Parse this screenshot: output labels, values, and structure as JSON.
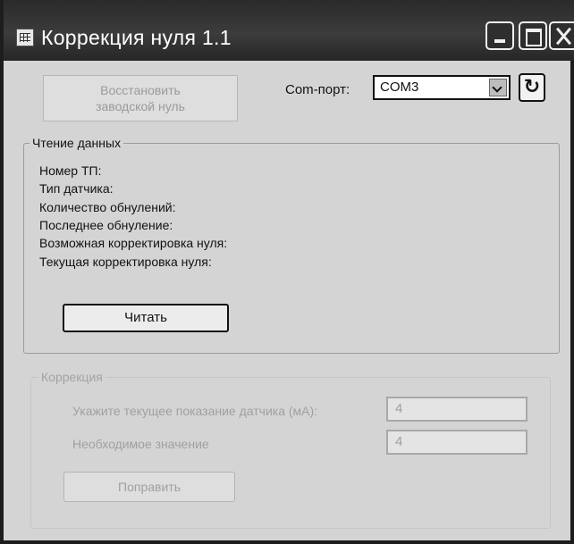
{
  "window": {
    "title": "Коррекция нуля 1.1"
  },
  "toolbar": {
    "restore_label_line1": "Восстановить",
    "restore_label_line2": "заводской нуль",
    "com_port_label": "Com-порт:",
    "com_port_value": "COM3",
    "refresh_icon_glyph": "↻"
  },
  "read_group": {
    "title": "Чтение данных",
    "fields": [
      "Номер ТП:",
      "Тип датчика:",
      "Количество обнулений:",
      "Последнее обнуление:",
      "Возможная корректировка нуля:",
      "Текущая корректировка нуля:"
    ],
    "read_button": "Читать"
  },
  "correction_group": {
    "title": "Коррекция",
    "current_reading_label": "Укажите текущее показание датчика (мА):",
    "current_reading_value": "4",
    "required_value_label": "Необходимое значение",
    "required_value": "4",
    "fix_button": "Поправить"
  }
}
